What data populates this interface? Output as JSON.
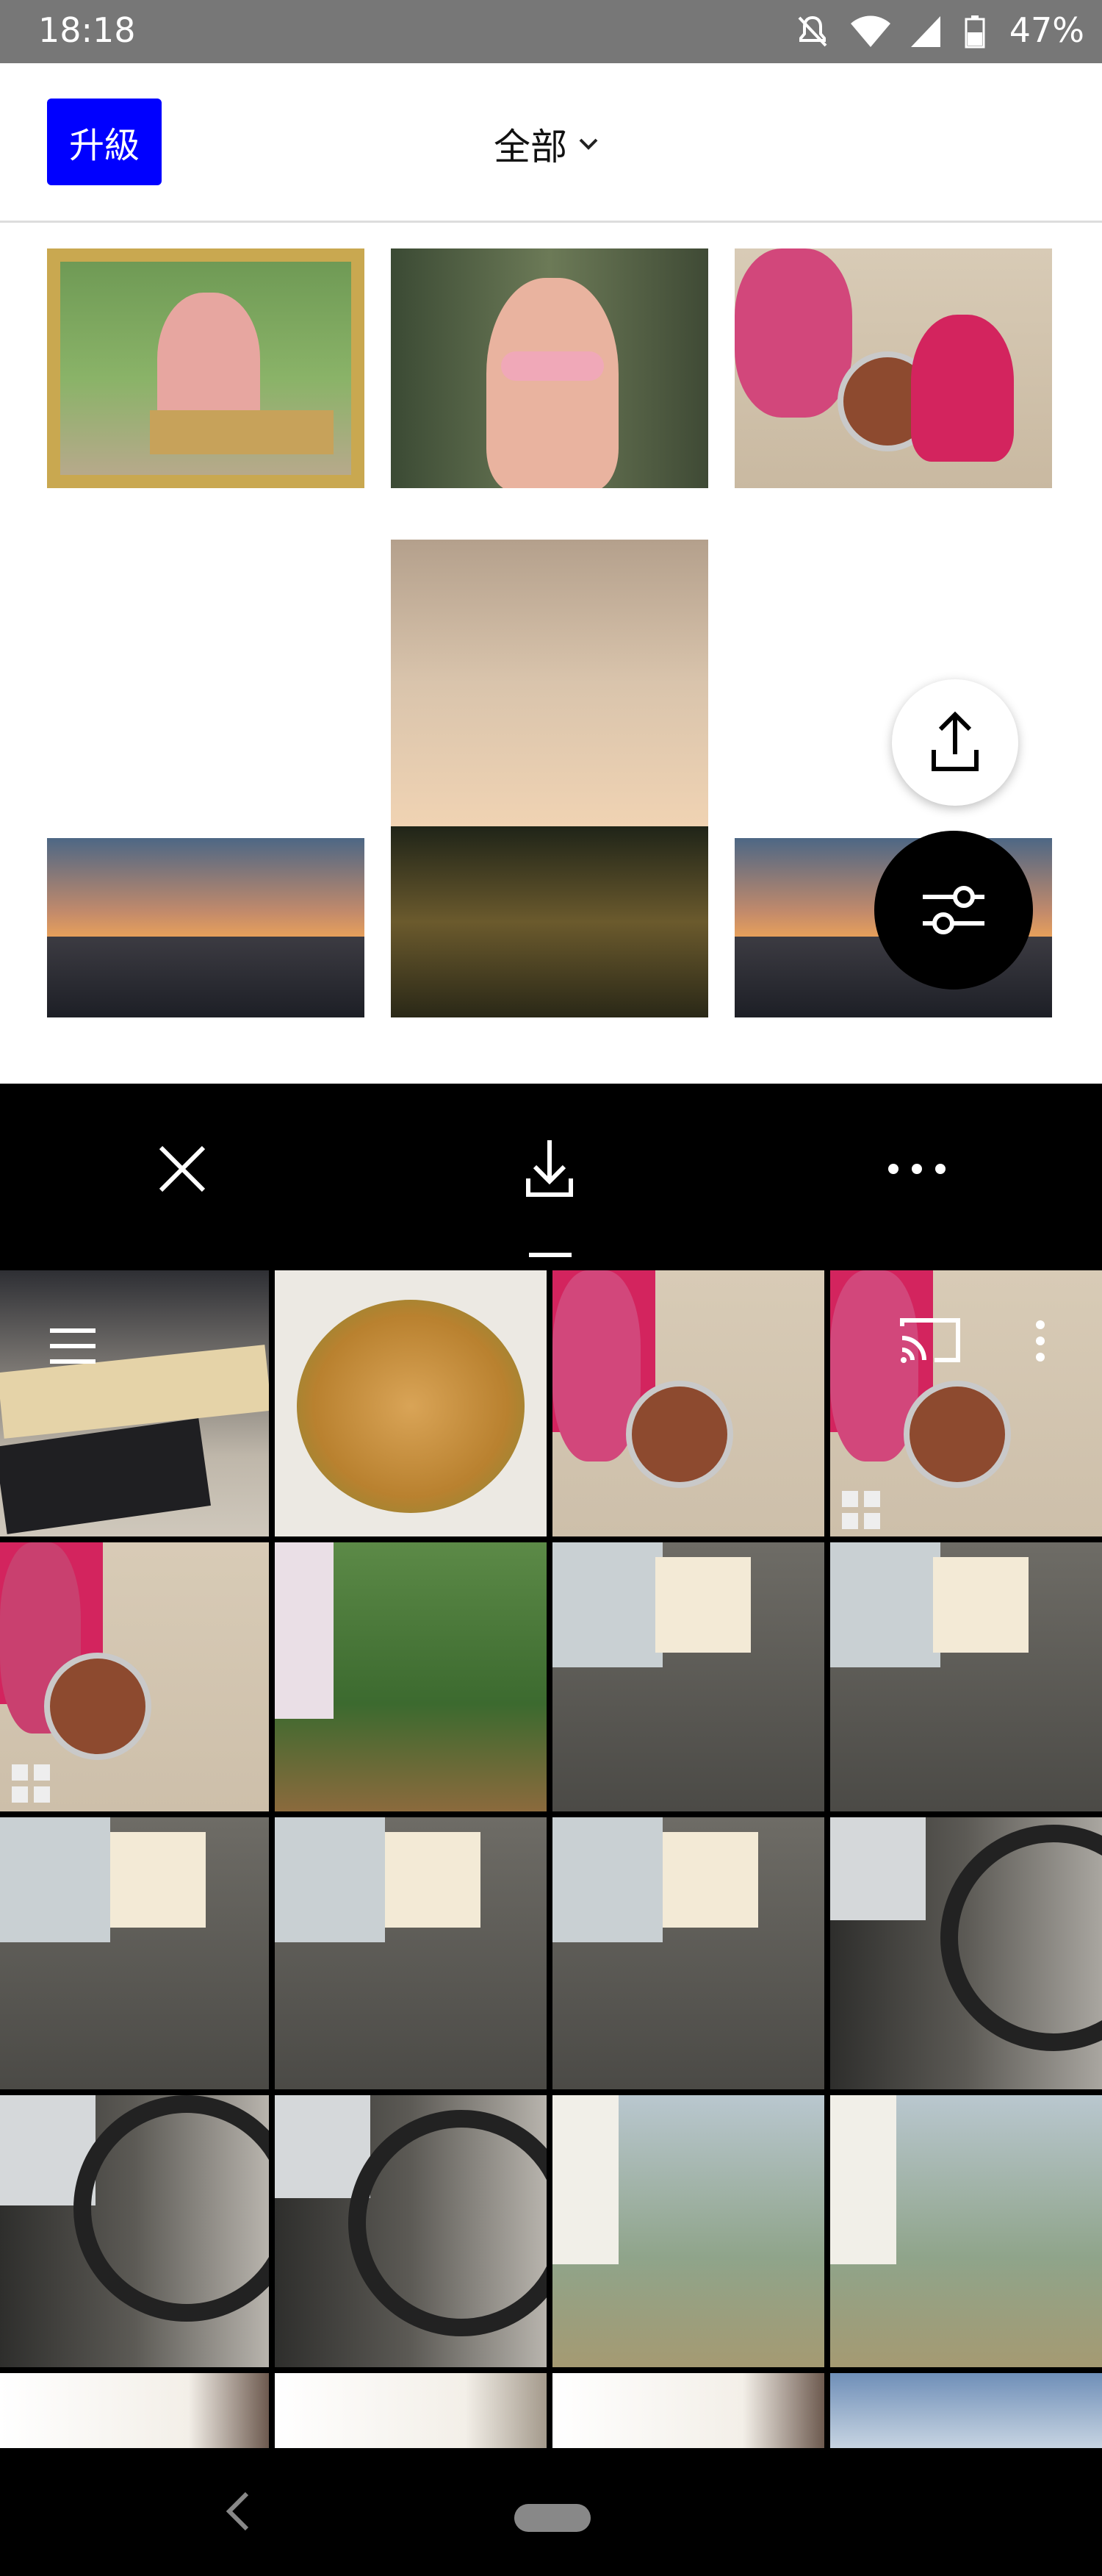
{
  "status_bar": {
    "time": "18:18",
    "battery": "47%",
    "icons": [
      "mute-icon",
      "wifi-icon",
      "signal-icon",
      "battery-icon"
    ]
  },
  "top_bar": {
    "upgrade_label": "升級",
    "filter_label": "全部",
    "accent": "#0000ff"
  },
  "sheet": {
    "icons": [
      "close-icon",
      "download-icon",
      "more-icon",
      "menu-icon",
      "cast-icon",
      "overflow-icon",
      "grid-icon",
      "back-icon"
    ]
  }
}
